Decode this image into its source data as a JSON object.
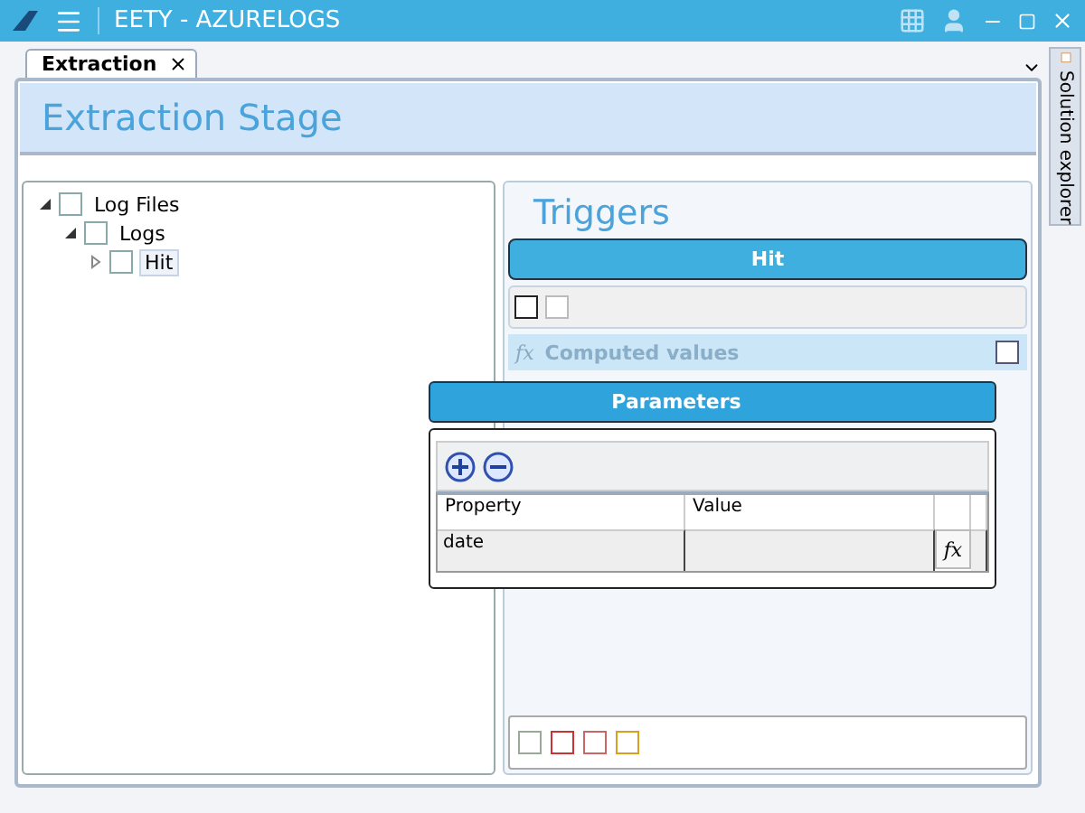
{
  "window": {
    "title": "EETY - AZURELOGS"
  },
  "tabs": [
    {
      "label": "Extraction",
      "selected": true
    }
  ],
  "stage": {
    "title": "Extraction Stage"
  },
  "tree": [
    {
      "label": "Log Files",
      "expanded": true,
      "selected": false,
      "children": [
        {
          "label": "Logs",
          "expanded": true,
          "selected": false,
          "children": [
            {
              "label": "Hit",
              "expanded": false,
              "selected": true
            }
          ]
        }
      ]
    }
  ],
  "triggers": {
    "title": "Triggers",
    "trigger_button": "Hit",
    "computed_icon": "fx",
    "computed_values": "Computed values"
  },
  "parameters_popup": {
    "title": "Parameters",
    "columns": [
      "Property",
      "Value"
    ],
    "rows": [
      {
        "property": "date",
        "fx_button": "fx"
      }
    ]
  },
  "side_panel": {
    "label": "Solution explorer"
  }
}
